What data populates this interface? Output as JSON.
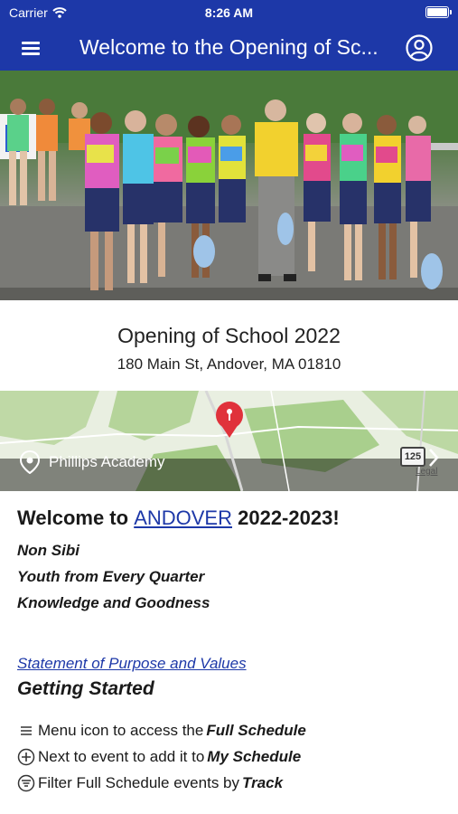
{
  "status_bar": {
    "carrier": "Carrier",
    "time": "8:26 AM"
  },
  "nav": {
    "title": "Welcome to the Opening of Sc...",
    "menu_icon": "hamburger-menu-icon",
    "account_icon": "user-circle-icon"
  },
  "event": {
    "title": "Opening of School 2022",
    "address": "180 Main St, Andover, MA 01810"
  },
  "map": {
    "place_label": "Phillips Academy",
    "route_number": "125",
    "legal_label": "Legal"
  },
  "content": {
    "welcome_prefix": "Welcome to",
    "welcome_link": "ANDOVER",
    "welcome_suffix": "2022-2023!",
    "mottos": [
      "Non Sibi",
      "Youth from Every Quarter",
      "Knowledge and Goodness"
    ],
    "purpose_link": "Statement of Purpose and Values",
    "getting_started": "Getting Started",
    "tips": [
      {
        "icon": "menu-lines-icon",
        "text": "Menu icon to access the ",
        "bold": "Full Schedule"
      },
      {
        "icon": "add-circle-icon",
        "text": "Next to event to add it to ",
        "bold": "My Schedule"
      },
      {
        "icon": "filter-circle-icon",
        "text": "Filter Full Schedule events by ",
        "bold": "Track"
      }
    ]
  },
  "colors": {
    "brand": "#1d38a8",
    "link": "#1d38a8",
    "map_pin": "#e0323b"
  }
}
